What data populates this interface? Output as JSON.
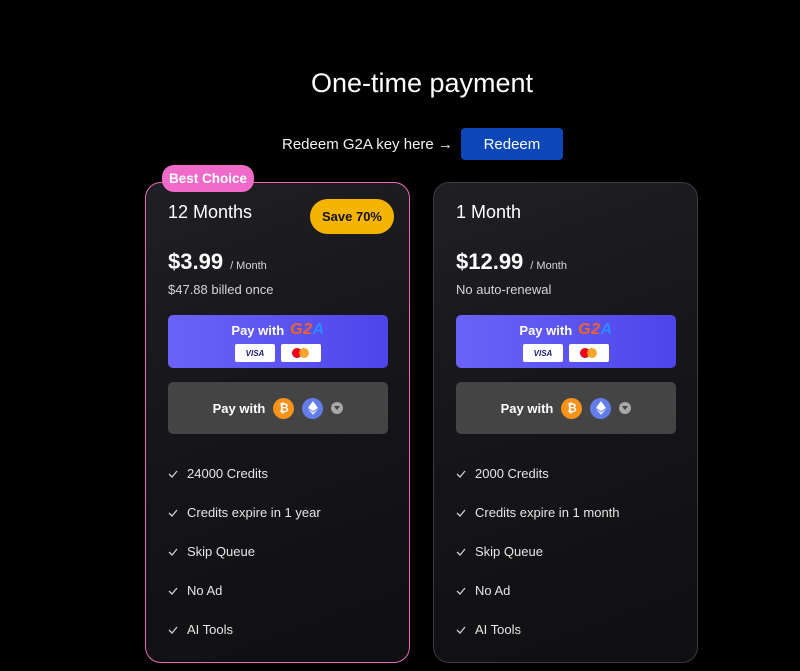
{
  "header": {
    "title": "One-time payment"
  },
  "redeem": {
    "text": "Redeem G2A key here →",
    "button_label": "Redeem"
  },
  "plans": [
    {
      "badge": "Best Choice",
      "name": "12 Months",
      "save_badge": "Save 70%",
      "price": "$3.99",
      "period": "/ Month",
      "billing": "$47.88 billed once",
      "pay_g2a_label": "Pay with",
      "g2a_logo": "G2A",
      "card_visa": "VISA",
      "pay_crypto_label": "Pay with",
      "features": [
        "24000 Credits",
        "Credits expire in 1 year",
        "Skip Queue",
        "No Ad",
        "AI Tools"
      ]
    },
    {
      "name": "1 Month",
      "price": "$12.99",
      "period": "/ Month",
      "billing": "No auto-renewal",
      "pay_g2a_label": "Pay with",
      "g2a_logo": "G2A",
      "card_visa": "VISA",
      "pay_crypto_label": "Pay with",
      "features": [
        "2000 Credits",
        "Credits expire in 1 month",
        "Skip Queue",
        "No Ad",
        "AI Tools"
      ]
    }
  ],
  "icons": {
    "bitcoin": "bitcoin-icon",
    "ethereum": "ethereum-icon",
    "more_coins": "chevron-down-icon",
    "check": "check-icon",
    "visa": "visa-icon",
    "mastercard": "mastercard-icon"
  },
  "colors": {
    "background": "#000000",
    "best_border": "#e669b7",
    "best_badge": "#f06bc9",
    "save_badge": "#f5b400",
    "redeem_button": "#0b47b6",
    "g2a_button": "#5b52f2",
    "crypto_button": "#444444"
  }
}
